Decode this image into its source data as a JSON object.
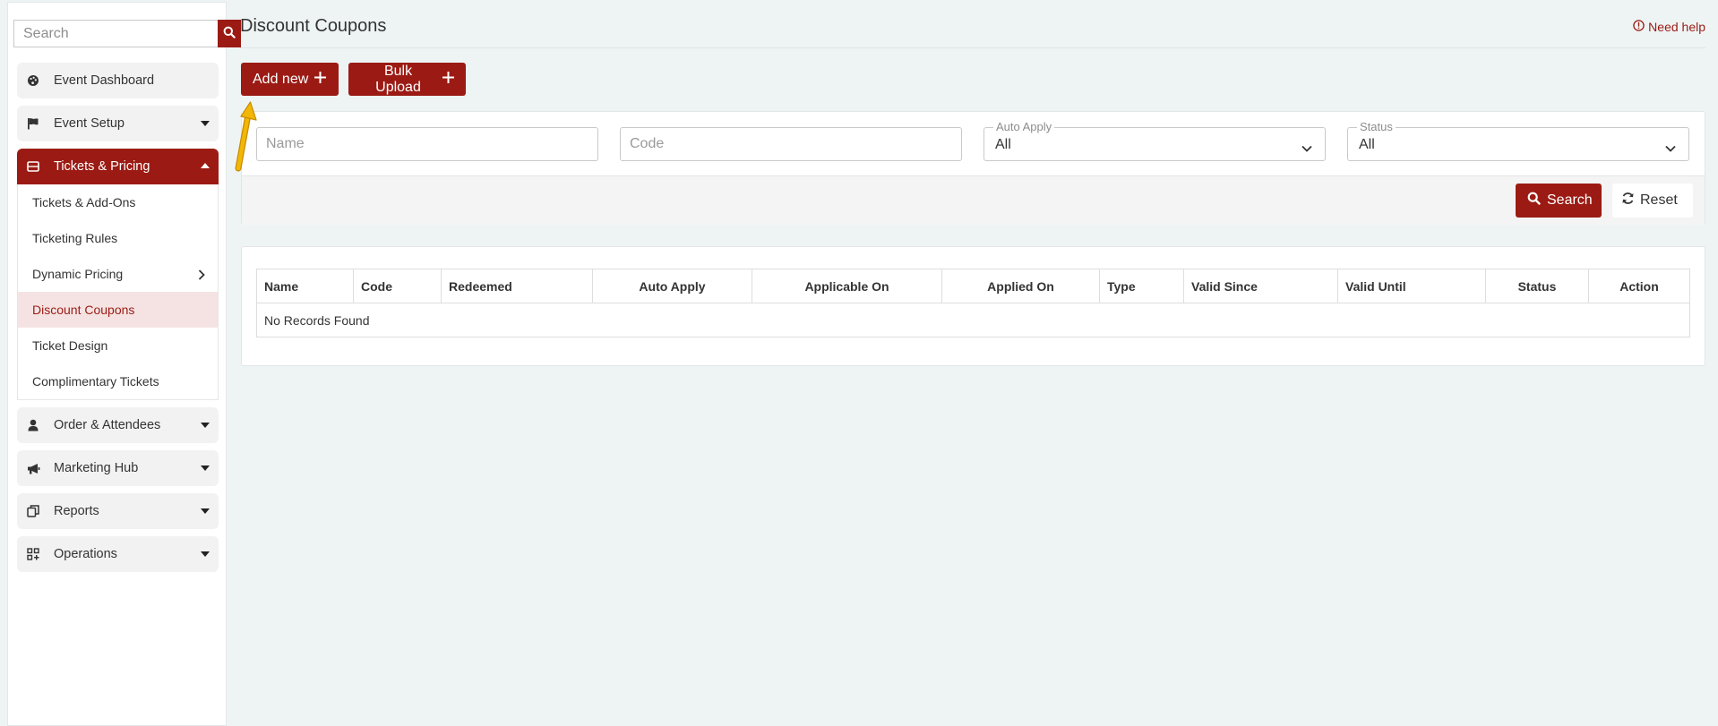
{
  "sidebar": {
    "search_placeholder": "Search",
    "items": [
      {
        "label": "Event Dashboard",
        "icon": "palette-icon"
      },
      {
        "label": "Event Setup",
        "icon": "flag-icon"
      },
      {
        "label": "Tickets & Pricing",
        "icon": "ticket-icon",
        "active": true
      },
      {
        "label": "Order & Attendees",
        "icon": "user-icon"
      },
      {
        "label": "Marketing Hub",
        "icon": "megaphone-icon"
      },
      {
        "label": "Reports",
        "icon": "copy-icon"
      },
      {
        "label": "Operations",
        "icon": "grid-plus-icon"
      }
    ],
    "subitems": [
      {
        "label": "Tickets & Add-Ons"
      },
      {
        "label": "Ticketing Rules"
      },
      {
        "label": "Dynamic Pricing"
      },
      {
        "label": "Discount Coupons",
        "current": true
      },
      {
        "label": "Ticket Design"
      },
      {
        "label": "Complimentary Tickets"
      }
    ]
  },
  "header": {
    "title": "Discount Coupons",
    "help": "Need help"
  },
  "actions": {
    "add_new": "Add new",
    "bulk_upload": "Bulk Upload"
  },
  "filters": {
    "name_placeholder": "Name",
    "code_placeholder": "Code",
    "auto_apply_label": "Auto Apply",
    "auto_apply_value": "All",
    "status_label": "Status",
    "status_value": "All",
    "search_button": "Search",
    "reset_button": "Reset"
  },
  "table": {
    "columns": [
      "Name",
      "Code",
      "Redeemed",
      "Auto Apply",
      "Applicable On",
      "Applied On",
      "Type",
      "Valid Since",
      "Valid Until",
      "Status",
      "Action"
    ],
    "empty_text": "No Records Found"
  },
  "colors": {
    "brand": "#9b1b14",
    "background": "#eef4f4",
    "highlight": "#f5e3e3",
    "annotation_arrow": "#f2b705"
  }
}
